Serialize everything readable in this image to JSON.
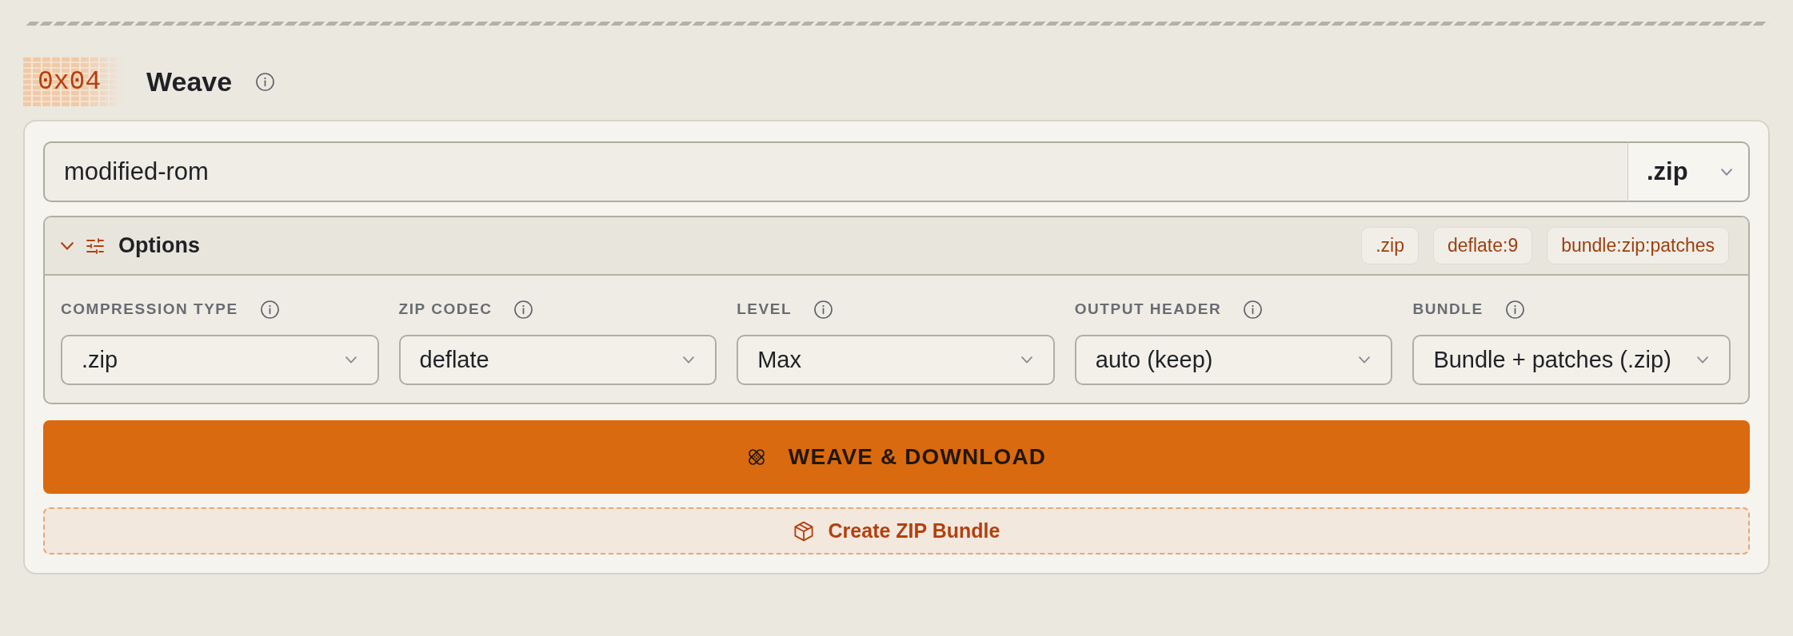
{
  "section": {
    "number": "0x04",
    "title": "Weave"
  },
  "filename": {
    "value": "modified-rom",
    "extension": ".zip"
  },
  "options": {
    "title": "Options",
    "expanded": true,
    "tags": [
      ".zip",
      "deflate:9",
      "bundle:zip:patches"
    ],
    "fields": [
      {
        "label": "COMPRESSION TYPE",
        "value": ".zip"
      },
      {
        "label": "ZIP CODEC",
        "value": "deflate"
      },
      {
        "label": "LEVEL",
        "value": "Max"
      },
      {
        "label": "OUTPUT HEADER",
        "value": "auto (keep)"
      },
      {
        "label": "BUNDLE",
        "value": "Bundle + patches (.zip)"
      }
    ]
  },
  "actions": [
    {
      "kind": "primary",
      "label": "WEAVE & DOWNLOAD"
    },
    {
      "kind": "secondary",
      "label": "Create ZIP Bundle"
    }
  ]
}
